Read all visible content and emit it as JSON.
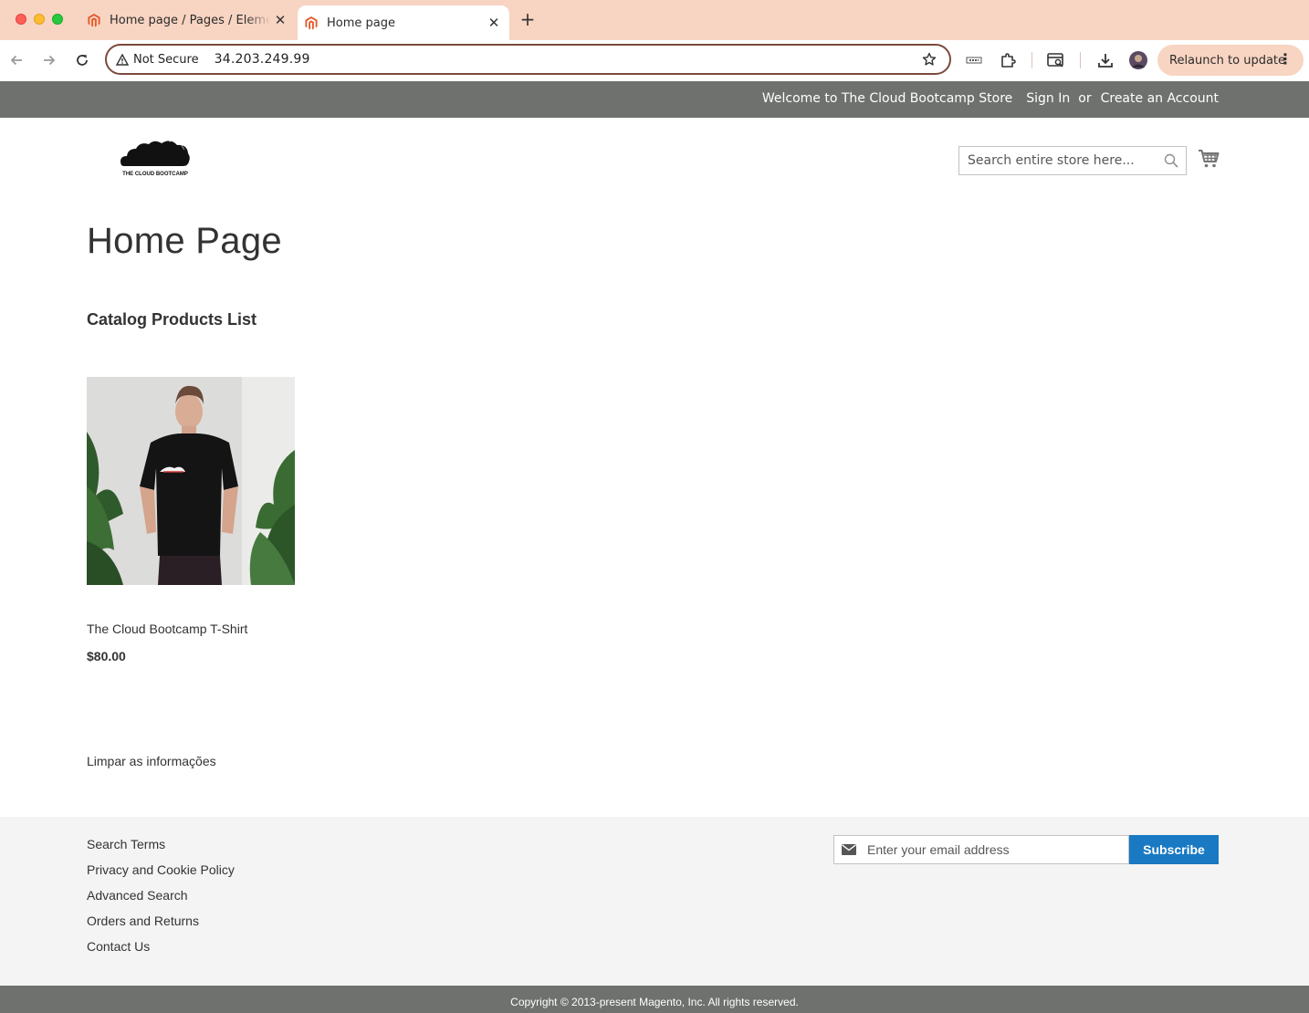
{
  "browser": {
    "tabs": [
      {
        "title": "Home page / Pages / Elements",
        "favicon": "magento-icon",
        "active": false
      },
      {
        "title": "Home page",
        "favicon": "magento-icon",
        "active": true
      }
    ],
    "security_label": "Not Secure",
    "url": "34.203.249.99",
    "relaunch_label": "Relaunch to update",
    "tab_accent": "#f8d4c2"
  },
  "store": {
    "welcome": "Welcome to The Cloud Bootcamp Store",
    "sign_in": "Sign In",
    "or": "or",
    "create_account": "Create an Account",
    "logo_text": "THE CLOUD BOOTCAMP",
    "search_placeholder": "Search entire store here...",
    "panel_color": "#6e716e"
  },
  "main": {
    "page_title": "Home Page",
    "section_title": "Catalog Products List",
    "products": [
      {
        "name": "The Cloud Bootcamp T-Shirt",
        "price": "$80.00"
      }
    ],
    "clear_info": "Limpar as informações"
  },
  "footer": {
    "links": [
      "Search Terms",
      "Privacy and Cookie Policy",
      "Advanced Search",
      "Orders and Returns",
      "Contact Us"
    ],
    "email_placeholder": "Enter your email address",
    "subscribe_label": "Subscribe",
    "subscribe_color": "#1979c3",
    "copyright": "Copyright © 2013-present Magento, Inc. All rights reserved."
  }
}
